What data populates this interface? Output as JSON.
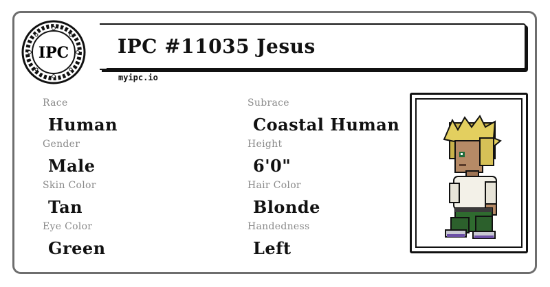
{
  "card": {
    "logo_text": "IPC",
    "title": "IPC #11035 Jesus",
    "site": "myipc.io"
  },
  "attributes": [
    {
      "label": "Race",
      "value": "Human"
    },
    {
      "label": "Subrace",
      "value": "Coastal Human"
    },
    {
      "label": "Gender",
      "value": "Male"
    },
    {
      "label": "Height",
      "value": "6'0\""
    },
    {
      "label": "Skin Color",
      "value": "Tan"
    },
    {
      "label": "Hair Color",
      "value": "Blonde"
    },
    {
      "label": "Eye Color",
      "value": "Green"
    },
    {
      "label": "Handedness",
      "value": "Left"
    }
  ],
  "colors": {
    "border": "#6e6e6e",
    "label": "#8a8a8a",
    "text": "#111111"
  },
  "icons": {
    "seal": "ipc-seal-icon",
    "avatar": "character-avatar"
  }
}
